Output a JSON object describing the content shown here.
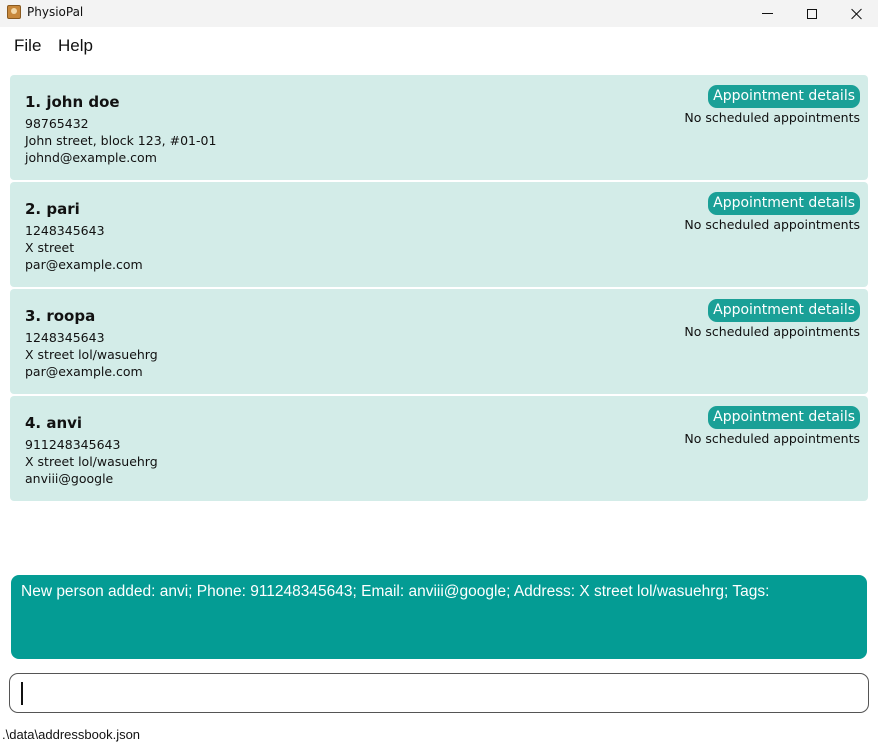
{
  "window": {
    "title": "PhysioPal"
  },
  "menu": {
    "file": "File",
    "help": "Help"
  },
  "persons": [
    {
      "index_name": "1. john doe",
      "phone": "98765432",
      "address": "John street, block 123, #01-01",
      "email": "johnd@example.com",
      "appointment_button": "Appointment details",
      "appointment_status": "No scheduled appointments"
    },
    {
      "index_name": "2. pari",
      "phone": "1248345643",
      "address": "X street",
      "email": "par@example.com",
      "appointment_button": "Appointment details",
      "appointment_status": "No scheduled appointments"
    },
    {
      "index_name": "3. roopa",
      "phone": "1248345643",
      "address": "X street lol/wasuehrg",
      "email": "par@example.com",
      "appointment_button": "Appointment details",
      "appointment_status": "No scheduled appointments"
    },
    {
      "index_name": "4. anvi",
      "phone": "911248345643",
      "address": "X street lol/wasuehrg",
      "email": "anviii@google",
      "appointment_button": "Appointment details",
      "appointment_status": "No scheduled appointments"
    }
  ],
  "result": {
    "message": "New person added: anvi; Phone: 911248345643; Email: anviii@google; Address: X street lol/wasuehrg; Tags:"
  },
  "command": {
    "value": ""
  },
  "status": {
    "file_path": ".\\data\\addressbook.json"
  },
  "colors": {
    "card_background": "#d3ece8",
    "accent": "#1aa097",
    "result_background": "#049c94"
  },
  "icons": {
    "app": "app-icon",
    "minimize": "minimize-icon",
    "maximize": "maximize-icon",
    "close": "close-icon"
  }
}
